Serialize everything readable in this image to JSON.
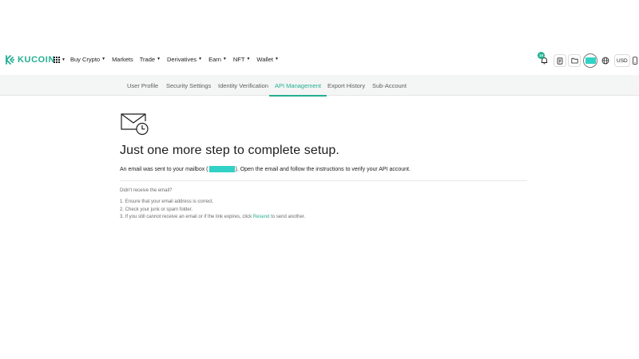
{
  "brand": {
    "name": "KUCOIN",
    "accent": "#23af91",
    "redaction": "#31d1c5"
  },
  "nav": {
    "items": [
      {
        "label": "Buy Crypto",
        "dropdown": true
      },
      {
        "label": "Markets",
        "dropdown": false
      },
      {
        "label": "Trade",
        "dropdown": true
      },
      {
        "label": "Derivatives",
        "dropdown": true
      },
      {
        "label": "Earn",
        "dropdown": true
      },
      {
        "label": "NFT",
        "dropdown": true
      },
      {
        "label": "Wallet",
        "dropdown": true
      }
    ],
    "notification_count": "10",
    "currency": "USD",
    "icons": [
      "apps-grid-icon",
      "bell-icon",
      "orders-icon",
      "folder-icon",
      "avatar",
      "globe-icon",
      "mobile-icon"
    ]
  },
  "subnav": {
    "tabs": [
      {
        "label": "User Profile",
        "active": false
      },
      {
        "label": "Security Settings",
        "active": false
      },
      {
        "label": "Identity Verification",
        "active": false
      },
      {
        "label": "API Management",
        "active": true
      },
      {
        "label": "Export History",
        "active": false
      },
      {
        "label": "Sub-Account",
        "active": false
      }
    ]
  },
  "main": {
    "heading": "Just one more step to complete setup.",
    "message_before": "An email was sent to your mailbox (",
    "message_after": "). Open the email and follow the instructions to verify your API account.",
    "didnt_receive": "Didn't receive the email?",
    "step1": "1. Ensure that your email address is correct.",
    "step2": "2. Check your junk or spam folder.",
    "step3_before": "3. If you still cannot receive an email or if the link expires, click ",
    "step3_link": "Resend",
    "step3_after": " to send another."
  }
}
